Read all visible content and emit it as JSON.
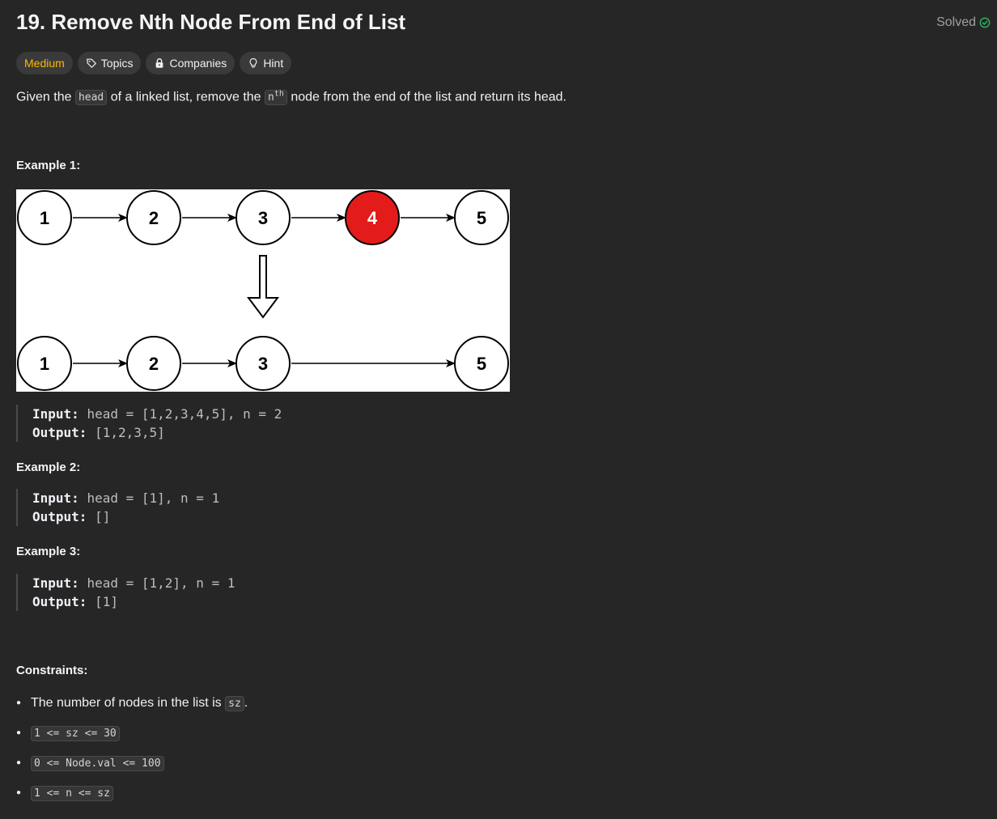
{
  "problem": {
    "title": "19. Remove Nth Node From End of List",
    "status": "Solved",
    "difficulty": "Medium",
    "tags": [
      "Topics",
      "Companies",
      "Hint"
    ]
  },
  "description": {
    "part1": "Given the ",
    "code1": "head",
    "part2": " of a linked list, remove the ",
    "code2_base": "n",
    "code2_sup": "th",
    "part3": " node from the end of the list and return its head."
  },
  "examples": [
    {
      "heading": "Example 1:",
      "input_label": "Input:",
      "input_value": "head = [1,2,3,4,5], n = 2",
      "output_label": "Output:",
      "output_value": "[1,2,3,5]",
      "diagram": {
        "top_nodes": [
          "1",
          "2",
          "3",
          "4",
          "5"
        ],
        "removed_node": "4",
        "bottom_nodes": [
          "1",
          "2",
          "3",
          "5"
        ]
      }
    },
    {
      "heading": "Example 2:",
      "input_label": "Input:",
      "input_value": "head = [1], n = 1",
      "output_label": "Output:",
      "output_value": "[]"
    },
    {
      "heading": "Example 3:",
      "input_label": "Input:",
      "input_value": "head = [1,2], n = 1",
      "output_label": "Output:",
      "output_value": "[1]"
    }
  ],
  "constraints": {
    "heading": "Constraints:",
    "first_text": "The number of nodes in the list is ",
    "first_code": "sz",
    "first_end": ".",
    "items": [
      "1 <= sz <= 30",
      "0 <= Node.val <= 100",
      "1 <= n <= sz"
    ]
  },
  "colors": {
    "background": "#262626",
    "medium": "#ffb800",
    "solved_check": "#2cbb5d",
    "removed_node": "#e31b1b"
  },
  "icons": [
    "check-circle-icon",
    "tag-icon",
    "lock-icon",
    "lightbulb-icon"
  ]
}
